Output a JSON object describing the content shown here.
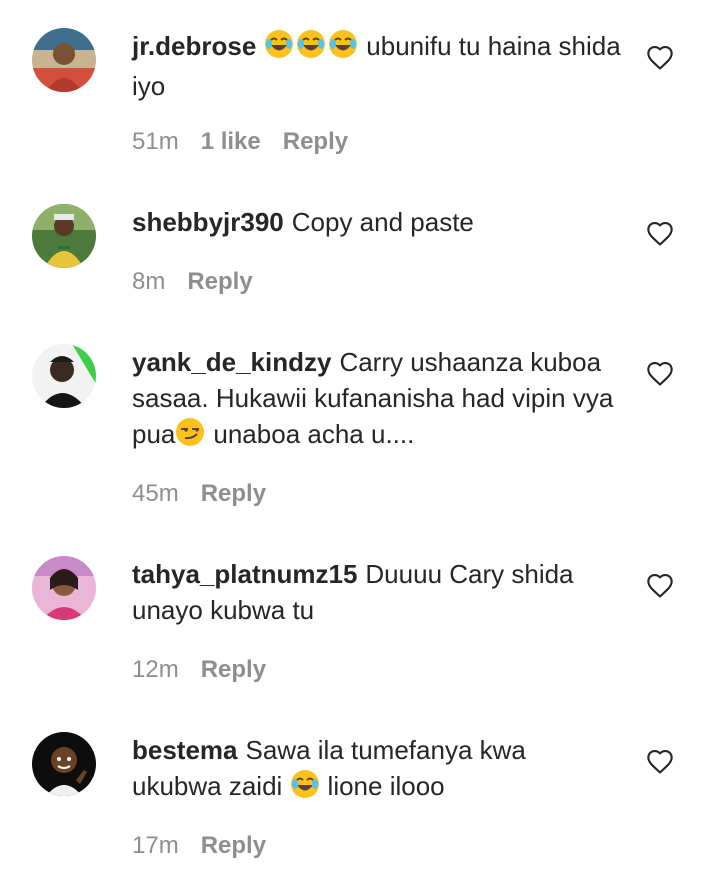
{
  "comments": [
    {
      "username": "jr.debrose",
      "text_after_emoji": "ubunifu tu haina shida iyo",
      "time": "51m",
      "likes": "1 like",
      "reply": "Reply"
    },
    {
      "username": "shebbyjr390",
      "text": "Copy and paste",
      "time": "8m",
      "reply": "Reply"
    },
    {
      "username": "yank_de_kindzy",
      "text_before_emoji": "Carry ushaanza kuboa sasaa. Hukawii kufananisha had vipin vya pua",
      "text_after_emoji": "unaboa acha u....",
      "time": "45m",
      "reply": "Reply"
    },
    {
      "username": "tahya_platnumz15",
      "text": "Duuuu Cary shida unayo kubwa tu",
      "time": "12m",
      "reply": "Reply"
    },
    {
      "username": "bestema",
      "text_before_emoji": "Sawa ila tumefanya kwa ukubwa zaidi",
      "text_after_emoji": "lione ilooo",
      "time": "17m",
      "reply": "Reply"
    }
  ],
  "icons": {
    "like": "heart-outline-icon",
    "laughing_emoji": "face-with-tears-of-joy-emoji",
    "smirk_emoji": "smirking-face-emoji"
  },
  "colors": {
    "text": "#262626",
    "meta": "#8e8e8e",
    "background": "#ffffff"
  }
}
